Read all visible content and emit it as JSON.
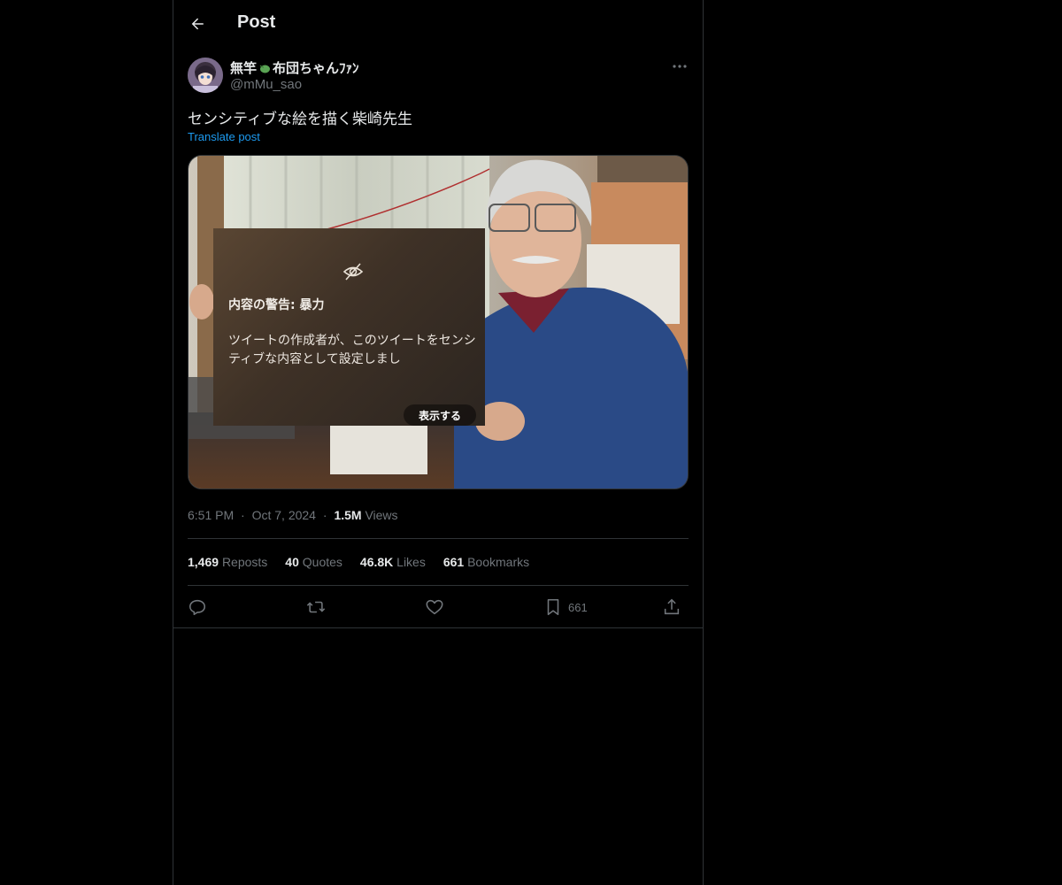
{
  "header": {
    "title": "Post",
    "back_icon": "arrow-left-icon"
  },
  "author": {
    "display_name_prefix": "無竿",
    "display_name_suffix": "布団ちゃんﾌｧﾝ",
    "handle": "@mMu_sao"
  },
  "post": {
    "text": "センシティブな絵を描く柴崎先生",
    "translate_label": "Translate post"
  },
  "media_warning": {
    "title": "内容の警告: 暴力",
    "body": "ツイートの作成者が、このツイートをセンシティブな内容として設定しまし",
    "button": "表示する"
  },
  "meta": {
    "time": "6:51 PM",
    "sep1": "·",
    "date": "Oct 7, 2024",
    "sep2": "·",
    "views_count": "1.5M",
    "views_label": "Views"
  },
  "stats": [
    {
      "num": "1,469",
      "label": "Reposts"
    },
    {
      "num": "40",
      "label": "Quotes"
    },
    {
      "num": "46.8K",
      "label": "Likes"
    },
    {
      "num": "661",
      "label": "Bookmarks"
    }
  ],
  "actions": {
    "bookmark_count": "661"
  },
  "colors": {
    "background": "#000000",
    "text": "#e7e9ea",
    "muted": "#71767b",
    "link": "#1d9bf0",
    "border": "#2f3336"
  }
}
